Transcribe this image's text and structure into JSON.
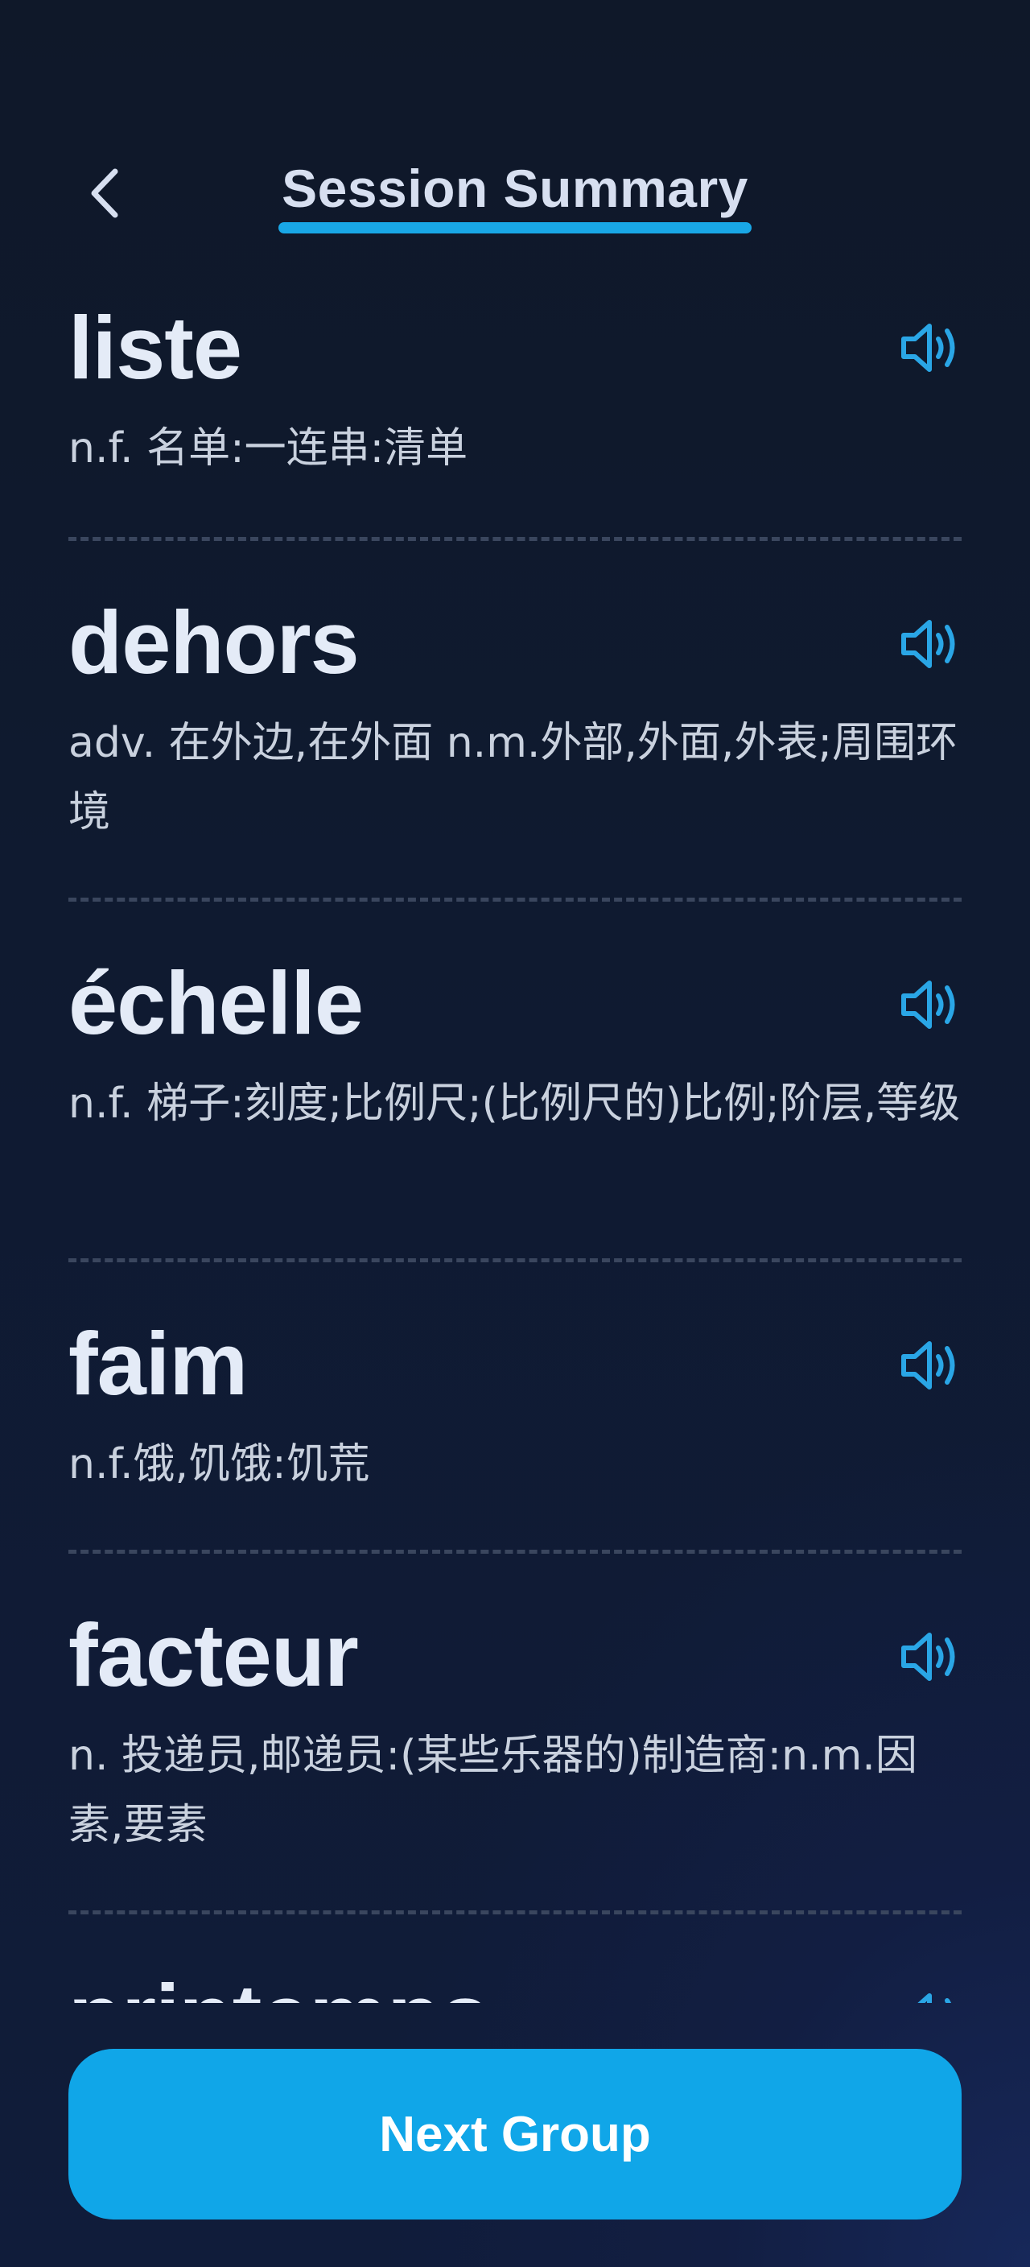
{
  "header": {
    "title": "Session Summary",
    "back_icon": "chevron-left-icon"
  },
  "colors": {
    "accent": "#19a7e6",
    "button": "#10a6e8",
    "background": "#0f1829",
    "divider": "#3a465e"
  },
  "entries": [
    {
      "word": "liste",
      "definition": "n.f. 名单:一连串:清单",
      "icon": "speaker-icon"
    },
    {
      "word": "dehors",
      "definition": "adv. 在外边,在外面 n.m.外部,外面,外表;周围环境",
      "icon": "speaker-icon"
    },
    {
      "word": "échelle",
      "definition": "n.f. 梯子:刻度;比例尺;(比例尺的)比例;阶层,等级",
      "icon": "speaker-icon"
    },
    {
      "word": "faim",
      "definition": "n.f.饿,饥饿:饥荒",
      "icon": "speaker-icon"
    },
    {
      "word": "facteur",
      "definition": "n. 投递员,邮递员:(某些乐器的)制造商:n.m.因素,要素",
      "icon": "speaker-icon"
    },
    {
      "word": "printemps",
      "definition": "",
      "icon": "speaker-icon"
    }
  ],
  "footer": {
    "next_label": "Next Group"
  }
}
